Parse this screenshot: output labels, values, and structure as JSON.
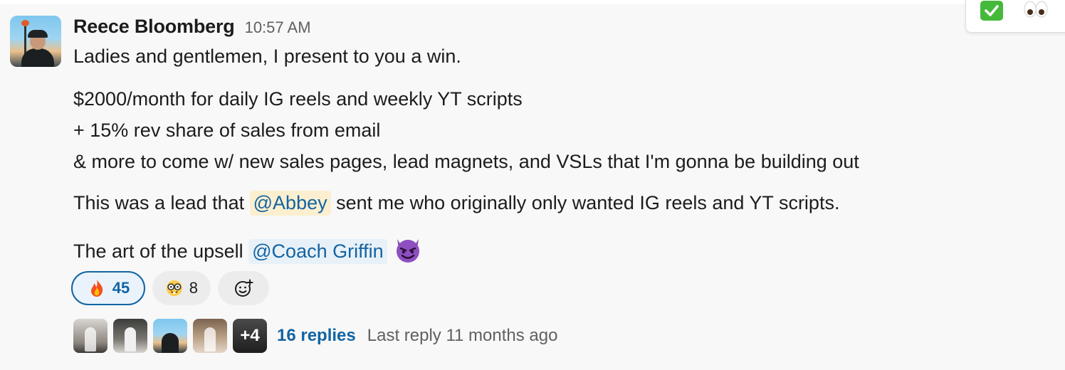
{
  "message": {
    "author": "Reece Bloomberg",
    "time": "10:57 AM",
    "lines": {
      "l1": "Ladies and gentlemen, I present to you a win.",
      "l2": "$2000/month for daily IG reels and weekly YT scripts",
      "l3": "+ 15% rev share of sales from email",
      "l4": "& more to come w/ new sales pages, lead magnets, and VSLs that I'm gonna be building out",
      "l5a": "This was a lead that ",
      "l5_mention": "@Abbey",
      "l5b": " sent me who originally only wanted IG reels and YT scripts.",
      "l6a": "The art of the upsell ",
      "l6_mention": "@Coach Griffin"
    },
    "inline_emoji": "smiling-imp-icon"
  },
  "reactions": [
    {
      "emoji": "fire-icon",
      "count": "45",
      "active": true
    },
    {
      "emoji": "nerd-face-icon",
      "count": "8",
      "active": false
    },
    {
      "emoji": "add-reaction-icon",
      "count": null
    }
  ],
  "thread": {
    "avatar_overflow": "+4",
    "replies": "16 replies",
    "last_reply": "Last reply 11 months ago"
  },
  "hover_toolbar": {
    "items": [
      "white-check-mark-icon",
      "eyes-icon"
    ]
  },
  "colors": {
    "link": "#1264a3",
    "mention_bg": "#e8f1f8",
    "mention_highlight_bg": "#fbefd0",
    "reaction_active_border": "#1264a3",
    "check_green": "#45b93a"
  }
}
